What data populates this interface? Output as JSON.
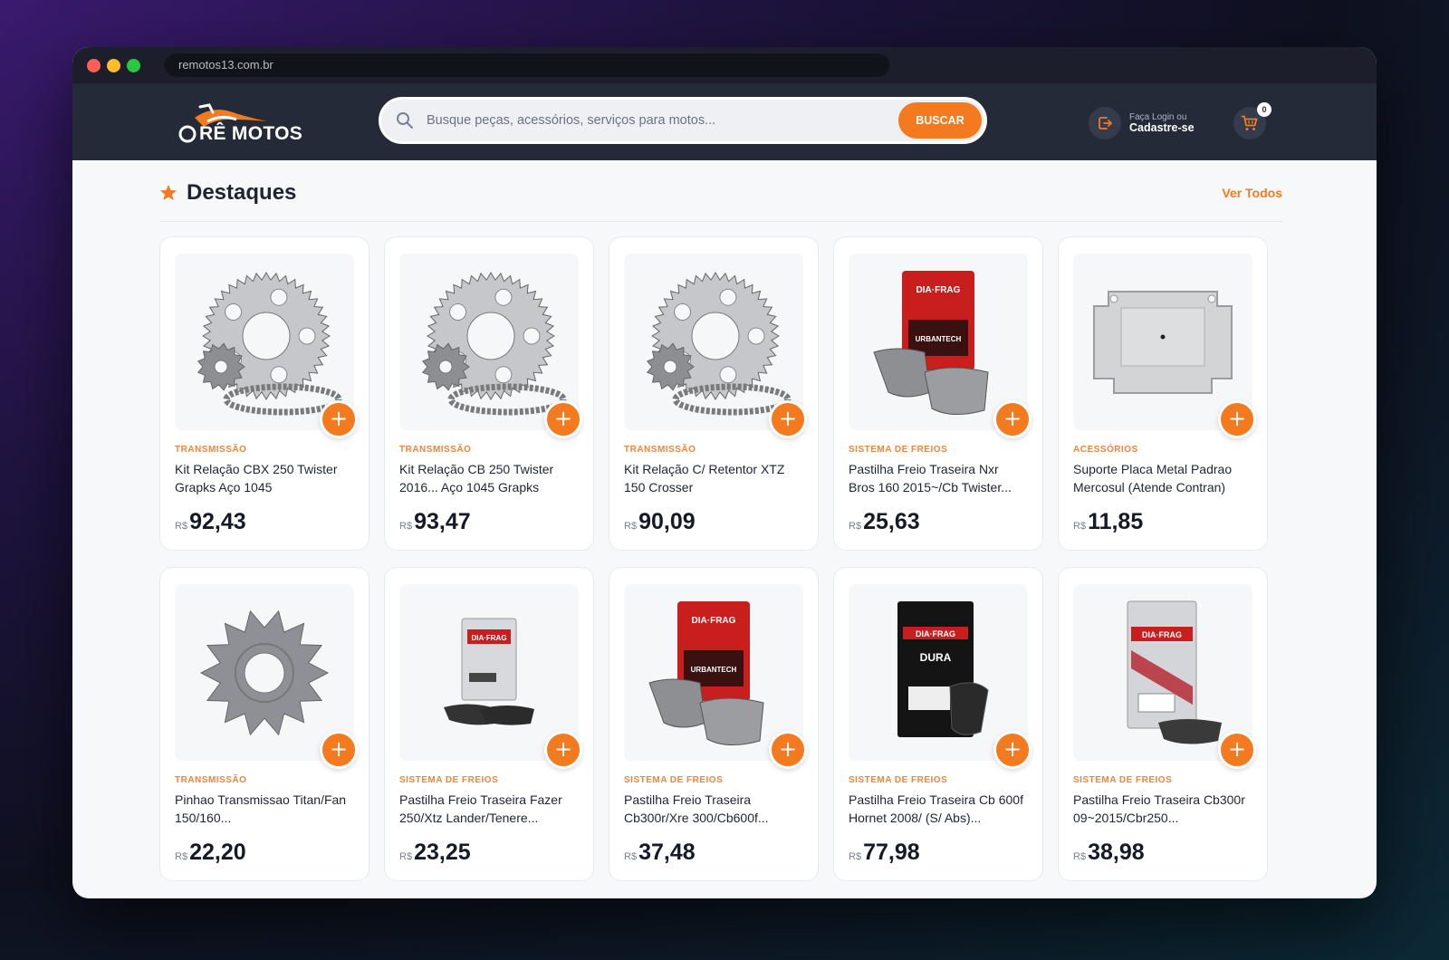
{
  "browser": {
    "url": "remotos13.com.br"
  },
  "header": {
    "logo_text": "RÊ MOTOS",
    "search_placeholder": "Busque peças, acessórios, serviços para motos...",
    "search_button": "BUSCAR",
    "login_small": "Faça Login ou",
    "login_big": "Cadastre-se",
    "cart_count": "0"
  },
  "section": {
    "title": "Destaques",
    "view_all": "Ver Todos"
  },
  "colors": {
    "accent": "#f47a1f",
    "header_bg": "#242a38",
    "text_dark": "#1f2433"
  },
  "products": [
    {
      "category": "TRANSMISSÃO",
      "name": "Kit Relação CBX 250 Twister Grapks Aço 1045",
      "currency": "R$",
      "price": "92,43",
      "image": "chain-kit"
    },
    {
      "category": "TRANSMISSÃO",
      "name": "Kit Relação CB 250 Twister 2016... Aço 1045 Grapks",
      "currency": "R$",
      "price": "93,47",
      "image": "chain-kit"
    },
    {
      "category": "TRANSMISSÃO",
      "name": "Kit Relação C/ Retentor XTZ 150 Crosser",
      "currency": "R$",
      "price": "90,09",
      "image": "chain-kit"
    },
    {
      "category": "SISTEMA DE FREIOS",
      "name": "Pastilha Freio Traseira Nxr Bros 160 2015~/Cb Twister...",
      "currency": "R$",
      "price": "25,63",
      "image": "brake-pad-red"
    },
    {
      "category": "ACESSÓRIOS",
      "name": "Suporte Placa Metal Padrao Mercosul (Atende Contran)",
      "currency": "R$",
      "price": "11,85",
      "image": "plate-holder"
    },
    {
      "category": "TRANSMISSÃO",
      "name": "Pinhao Transmissao Titan/Fan 150/160...",
      "currency": "R$",
      "price": "22,20",
      "image": "sprocket"
    },
    {
      "category": "SISTEMA DE FREIOS",
      "name": "Pastilha Freio Traseira Fazer 250/Xtz Lander/Tenere...",
      "currency": "R$",
      "price": "23,25",
      "image": "brake-pad-small"
    },
    {
      "category": "SISTEMA DE FREIOS",
      "name": "Pastilha Freio Traseira Cb300r/Xre 300/Cb600f...",
      "currency": "R$",
      "price": "37,48",
      "image": "brake-pad-red"
    },
    {
      "category": "SISTEMA DE FREIOS",
      "name": "Pastilha Freio Traseira Cb 600f Hornet 2008/ (S/ Abs)...",
      "currency": "R$",
      "price": "77,98",
      "image": "brake-pad-black"
    },
    {
      "category": "SISTEMA DE FREIOS",
      "name": "Pastilha Freio Traseira Cb300r 09~2015/Cbr250...",
      "currency": "R$",
      "price": "38,98",
      "image": "brake-pad-gray"
    }
  ]
}
